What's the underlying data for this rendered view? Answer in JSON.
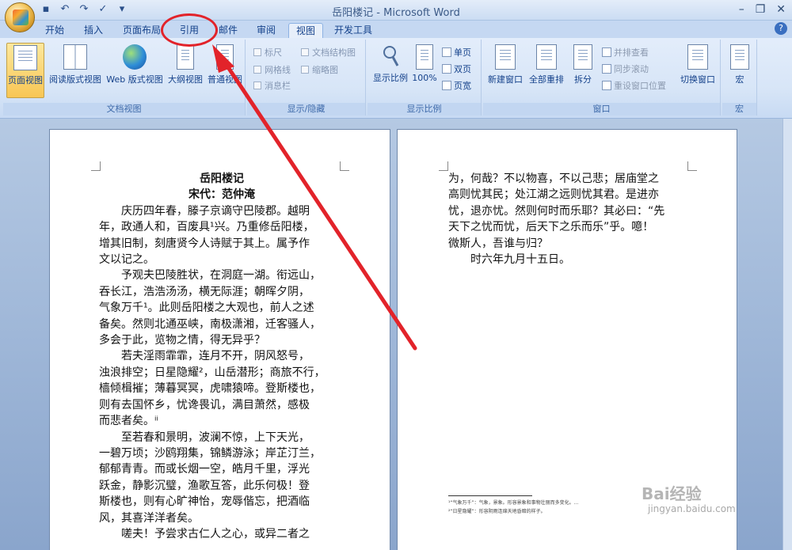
{
  "window": {
    "title": "岳阳楼记 - Microsoft Word"
  },
  "qat_icons": [
    "save-icon",
    "undo-icon",
    "redo-icon",
    "spelling-icon",
    "customize-icon"
  ],
  "tabs": [
    {
      "label": "开始"
    },
    {
      "label": "插入"
    },
    {
      "label": "页面布局"
    },
    {
      "label": "引用"
    },
    {
      "label": "邮件"
    },
    {
      "label": "审阅"
    },
    {
      "label": "视图"
    },
    {
      "label": "开发工具"
    }
  ],
  "ribbon": {
    "doc_views": {
      "label": "文档视图",
      "buttons": [
        "页面视图",
        "阅读版式视图",
        "Web 版式视图",
        "大纲视图",
        "普通视图"
      ]
    },
    "show_hide": {
      "label": "显示/隐藏",
      "items": [
        "标尺",
        "文档结构图",
        "网格线",
        "缩略图",
        "消息栏"
      ]
    },
    "zoom": {
      "label": "显示比例",
      "buttons": [
        "显示比例",
        "100%"
      ],
      "small": [
        "单页",
        "双页",
        "页宽"
      ]
    },
    "window": {
      "label": "窗口",
      "buttons": [
        "新建窗口",
        "全部重排",
        "拆分"
      ],
      "small": [
        "并排查看",
        "同步滚动",
        "重设窗口位置"
      ],
      "switch": "切换窗口"
    },
    "macro": {
      "label": "宏",
      "button": "宏"
    }
  },
  "page1": {
    "title": "岳阳楼记",
    "author": "宋代：范仲淹",
    "lines": [
      "　　庆历四年春，滕子京谪守巴陵郡。越明",
      "年，政通人和，百废具¹兴。乃重修岳阳楼，",
      "增其旧制，刻唐贤今人诗赋于其上。属予作",
      "文以记之。",
      "　　予观夫巴陵胜状，在洞庭一湖。衔远山，",
      "吞长江，浩浩汤汤，横无际涯；朝晖夕阴，",
      "气象万千¹。此则岳阳楼之大观也，前人之述",
      "备矣。然则北通巫峡，南极潇湘，迁客骚人，",
      "多会于此，览物之情，得无异乎？",
      "　　若夫淫雨霏霏，连月不开，阴风怒号，",
      "浊浪排空；日星隐耀²，山岳潜形；商旅不行，",
      "樯倾楫摧；薄暮冥冥，虎啸猿啼。登斯楼也，",
      "则有去国怀乡，忧谗畏讥，满目萧然，感极",
      "而悲者矣。ⁱⁱ",
      "　　至若春和景明，波澜不惊，上下天光，",
      "一碧万顷；沙鸥翔集，锦鳞游泳；岸芷汀兰，",
      "郁郁青青。而或长烟一空，皓月千里，浮光",
      "跃金，静影沉璧，渔歌互答，此乐何极！登",
      "斯楼也，则有心旷神怡，宠辱偕忘，把酒临",
      "风，其喜洋洋者矣。",
      "　　嗟夫！予尝求古仁人之心，或异二者之"
    ]
  },
  "page2": {
    "lines": [
      "为，何哉？不以物喜，不以己悲；居庙堂之",
      "高则忧其民；处江湖之远则忧其君。是进亦",
      "忧，退亦忧。然则何时而乐耶？其必曰：“先",
      "天下之忧而忧，后天下之乐而乐”乎。噫！",
      "微斯人，吾谁与归？",
      "　　时六年九月十五日。"
    ],
    "footnotes": [
      "¹“气象万千”：气象，景象。形容景象和事物壮丽而多变化。...",
      "²“日星隐耀”：形容阴雨连绵天地昏暗的样子。"
    ]
  },
  "watermark": {
    "brand": "Bai经验",
    "url": "jingyan.baidu.com"
  }
}
